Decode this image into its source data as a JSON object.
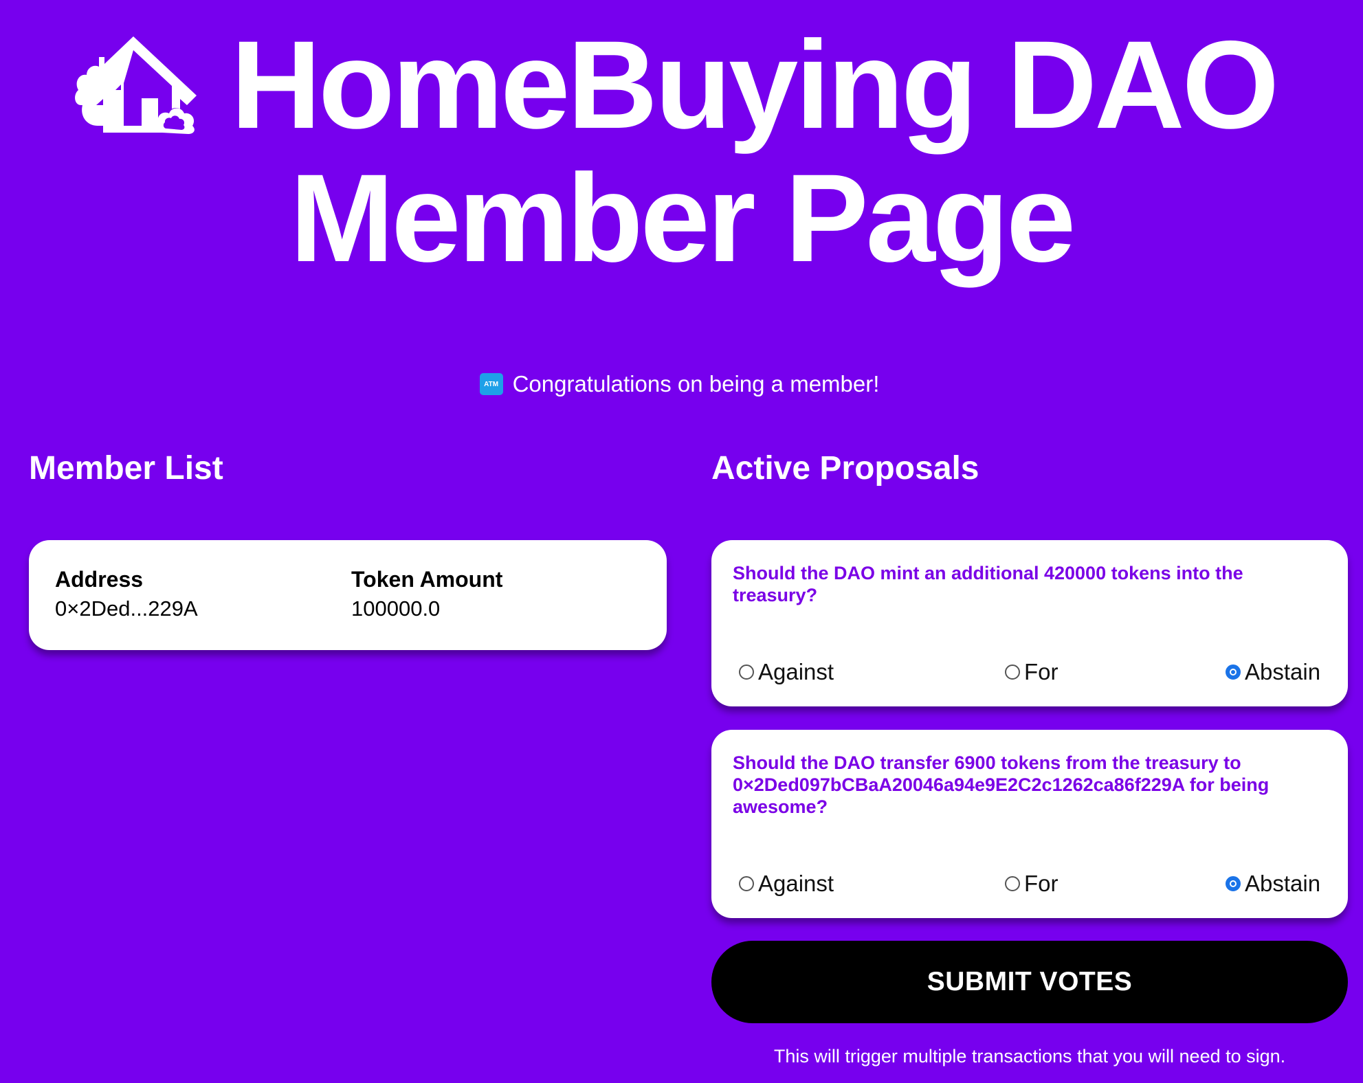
{
  "header": {
    "title_line1": "HomeBuying DAO",
    "title_line2": "Member Page",
    "icon": "house-icon"
  },
  "banner": {
    "icon": "atm-icon",
    "icon_text": "ATM",
    "text": "Congratulations on being a member!"
  },
  "members": {
    "title": "Member List",
    "columns": [
      "Address",
      "Token Amount"
    ],
    "rows": [
      {
        "address": "0×2Ded...229A",
        "amount": "100000.0"
      }
    ]
  },
  "proposals": {
    "title": "Active Proposals",
    "items": [
      {
        "question": "Should the DAO mint an additional 420000 tokens into the treasury?",
        "options": [
          "Against",
          "For",
          "Abstain"
        ],
        "selected": "Abstain"
      },
      {
        "question": "Should the DAO transfer 6900 tokens from the treasury to 0×2Ded097bCBaA20046a94e9E2C2c1262ca86f229A for being awesome?",
        "options": [
          "Against",
          "For",
          "Abstain"
        ],
        "selected": "Abstain"
      }
    ]
  },
  "actions": {
    "submit_label": "SUBMIT VOTES",
    "note": "This will trigger multiple transactions that you will need to sign."
  },
  "colors": {
    "background": "#7700ee",
    "question_text": "#7a00e6",
    "radio_selected": "#1a73e8",
    "button": "#000000"
  }
}
